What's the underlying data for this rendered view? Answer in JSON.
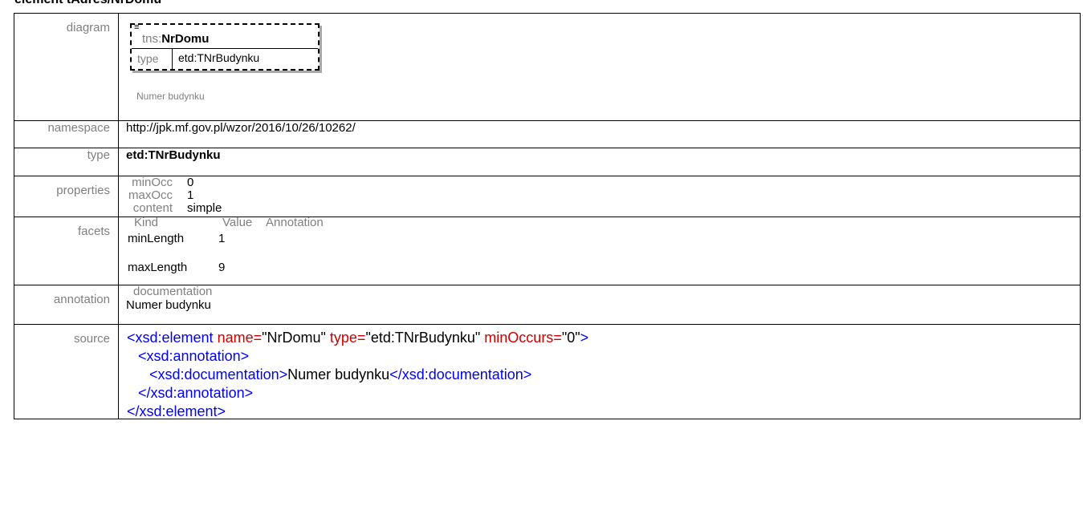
{
  "title": "element tAdres/NrDomu",
  "rows": {
    "diagram": {
      "label": "diagram",
      "menu_glyph": "≡",
      "prefix": "tns:",
      "name": "NrDomu",
      "type_label": "type",
      "type_value": "etd:TNrBudynku",
      "caption": "Numer budynku"
    },
    "namespace": {
      "label": "namespace",
      "value": "http://jpk.mf.gov.pl/wzor/2016/10/26/10262/"
    },
    "type": {
      "label": "type",
      "value": "etd:TNrBudynku"
    },
    "properties": {
      "label": "properties",
      "items": [
        {
          "key": "minOcc",
          "value": "0"
        },
        {
          "key": "maxOcc",
          "value": "1"
        },
        {
          "key": "content",
          "value": "simple"
        }
      ]
    },
    "facets": {
      "label": "facets",
      "headers": [
        "Kind",
        "Value",
        "Annotation"
      ],
      "rows": [
        {
          "kind": "minLength",
          "value": "1"
        },
        {
          "kind": "maxLength",
          "value": "9"
        }
      ]
    },
    "annotation": {
      "label": "annotation",
      "header": "documentation",
      "value": "Numer budynku"
    },
    "source": {
      "label": "source",
      "l1_open": "<xsd:element",
      "l1_attr1": " name=",
      "l1_val1": "\"NrDomu\"",
      "l1_attr2": " type=",
      "l1_val2": "\"etd:TNrBudynku\"",
      "l1_attr3": " minOccurs=",
      "l1_val3": "\"0\"",
      "l1_close": ">",
      "l2": "<xsd:annotation>",
      "l3_open": "<xsd:documentation>",
      "l3_text": "Numer budynku",
      "l3_close": "</xsd:documentation>",
      "l4": "</xsd:annotation>",
      "l5": "</xsd:element>"
    }
  }
}
